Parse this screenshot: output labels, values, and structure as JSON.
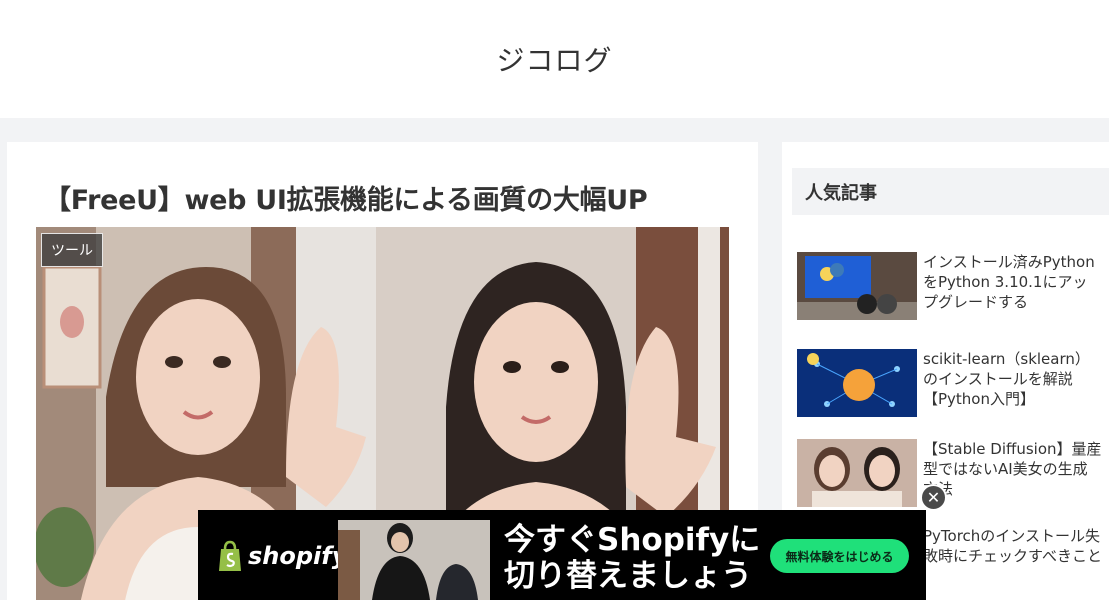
{
  "site": {
    "title": "ジコログ"
  },
  "article": {
    "title": "【FreeU】web UI拡張機能による画質の大幅UP",
    "category": "ツール"
  },
  "sidebar": {
    "widget_title": "人気記事",
    "items": [
      {
        "title": "インストール済みPythonをPython 3.10.1にアップグレードする"
      },
      {
        "title": "scikit-learn（sklearn）のインストールを解説【Python入門】"
      },
      {
        "title": "【Stable Diffusion】量産型ではないAI美女の生成方法"
      },
      {
        "title": "PyTorchのインストール失敗時にチェックすべきこと"
      }
    ]
  },
  "ad": {
    "brand": "shopify",
    "headline_line1": "今すぐShopifyに",
    "headline_line2": "切り替えましょう",
    "cta_label": "無料体験をはじめる",
    "close_label": "✕"
  },
  "colors": {
    "page_bg": "#f2f3f5",
    "card_bg": "#ffffff",
    "text": "#333333",
    "ad_bg": "#000000",
    "ad_cta": "#1fe07a"
  }
}
